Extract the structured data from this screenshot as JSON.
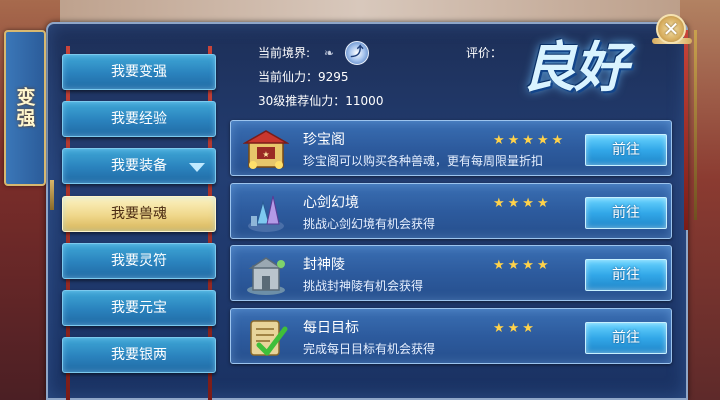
{
  "side_tab": {
    "label": "变强"
  },
  "menu": {
    "items": [
      {
        "label": "我要变强"
      },
      {
        "label": "我要经验"
      },
      {
        "label": "我要装备"
      },
      {
        "label": "我要兽魂"
      },
      {
        "label": "我要灵符"
      },
      {
        "label": "我要元宝"
      },
      {
        "label": "我要银两"
      }
    ],
    "active_index": 3
  },
  "header": {
    "realm_label": "当前境界:",
    "power_label": "当前仙力：",
    "power_value": "9295",
    "recommend_label": "30级推荐仙力：",
    "recommend_value": "11000",
    "rating_label": "评价：",
    "rating_value": "良好"
  },
  "tasks": [
    {
      "title": "珍宝阁",
      "desc": "珍宝阁可以购买各种兽魂，更有每周限量折扣",
      "stars": 5,
      "button": "前往",
      "icon": "treasure-pavilion-icon"
    },
    {
      "title": "心剑幻境",
      "desc": "挑战心剑幻境有机会获得",
      "stars": 4,
      "button": "前往",
      "icon": "sword-illusion-icon"
    },
    {
      "title": "封神陵",
      "desc": "挑战封神陵有机会获得",
      "stars": 4,
      "button": "前往",
      "icon": "tomb-icon"
    },
    {
      "title": "每日目标",
      "desc": "完成每日目标有机会获得",
      "stars": 3,
      "button": "前往",
      "icon": "checklist-scroll-icon"
    }
  ],
  "colors": {
    "star": "#ffd24a",
    "panel": "#233e73",
    "button": "#32a7e8"
  }
}
